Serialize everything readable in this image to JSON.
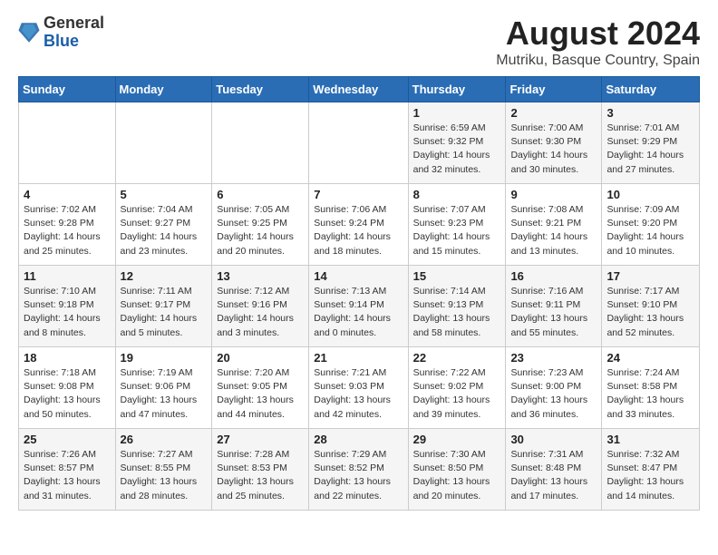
{
  "header": {
    "logo_general": "General",
    "logo_blue": "Blue",
    "month_title": "August 2024",
    "location": "Mutriku, Basque Country, Spain"
  },
  "weekdays": [
    "Sunday",
    "Monday",
    "Tuesday",
    "Wednesday",
    "Thursday",
    "Friday",
    "Saturday"
  ],
  "weeks": [
    [
      {
        "day": "",
        "detail": ""
      },
      {
        "day": "",
        "detail": ""
      },
      {
        "day": "",
        "detail": ""
      },
      {
        "day": "",
        "detail": ""
      },
      {
        "day": "1",
        "detail": "Sunrise: 6:59 AM\nSunset: 9:32 PM\nDaylight: 14 hours\nand 32 minutes."
      },
      {
        "day": "2",
        "detail": "Sunrise: 7:00 AM\nSunset: 9:30 PM\nDaylight: 14 hours\nand 30 minutes."
      },
      {
        "day": "3",
        "detail": "Sunrise: 7:01 AM\nSunset: 9:29 PM\nDaylight: 14 hours\nand 27 minutes."
      }
    ],
    [
      {
        "day": "4",
        "detail": "Sunrise: 7:02 AM\nSunset: 9:28 PM\nDaylight: 14 hours\nand 25 minutes."
      },
      {
        "day": "5",
        "detail": "Sunrise: 7:04 AM\nSunset: 9:27 PM\nDaylight: 14 hours\nand 23 minutes."
      },
      {
        "day": "6",
        "detail": "Sunrise: 7:05 AM\nSunset: 9:25 PM\nDaylight: 14 hours\nand 20 minutes."
      },
      {
        "day": "7",
        "detail": "Sunrise: 7:06 AM\nSunset: 9:24 PM\nDaylight: 14 hours\nand 18 minutes."
      },
      {
        "day": "8",
        "detail": "Sunrise: 7:07 AM\nSunset: 9:23 PM\nDaylight: 14 hours\nand 15 minutes."
      },
      {
        "day": "9",
        "detail": "Sunrise: 7:08 AM\nSunset: 9:21 PM\nDaylight: 14 hours\nand 13 minutes."
      },
      {
        "day": "10",
        "detail": "Sunrise: 7:09 AM\nSunset: 9:20 PM\nDaylight: 14 hours\nand 10 minutes."
      }
    ],
    [
      {
        "day": "11",
        "detail": "Sunrise: 7:10 AM\nSunset: 9:18 PM\nDaylight: 14 hours\nand 8 minutes."
      },
      {
        "day": "12",
        "detail": "Sunrise: 7:11 AM\nSunset: 9:17 PM\nDaylight: 14 hours\nand 5 minutes."
      },
      {
        "day": "13",
        "detail": "Sunrise: 7:12 AM\nSunset: 9:16 PM\nDaylight: 14 hours\nand 3 minutes."
      },
      {
        "day": "14",
        "detail": "Sunrise: 7:13 AM\nSunset: 9:14 PM\nDaylight: 14 hours\nand 0 minutes."
      },
      {
        "day": "15",
        "detail": "Sunrise: 7:14 AM\nSunset: 9:13 PM\nDaylight: 13 hours\nand 58 minutes."
      },
      {
        "day": "16",
        "detail": "Sunrise: 7:16 AM\nSunset: 9:11 PM\nDaylight: 13 hours\nand 55 minutes."
      },
      {
        "day": "17",
        "detail": "Sunrise: 7:17 AM\nSunset: 9:10 PM\nDaylight: 13 hours\nand 52 minutes."
      }
    ],
    [
      {
        "day": "18",
        "detail": "Sunrise: 7:18 AM\nSunset: 9:08 PM\nDaylight: 13 hours\nand 50 minutes."
      },
      {
        "day": "19",
        "detail": "Sunrise: 7:19 AM\nSunset: 9:06 PM\nDaylight: 13 hours\nand 47 minutes."
      },
      {
        "day": "20",
        "detail": "Sunrise: 7:20 AM\nSunset: 9:05 PM\nDaylight: 13 hours\nand 44 minutes."
      },
      {
        "day": "21",
        "detail": "Sunrise: 7:21 AM\nSunset: 9:03 PM\nDaylight: 13 hours\nand 42 minutes."
      },
      {
        "day": "22",
        "detail": "Sunrise: 7:22 AM\nSunset: 9:02 PM\nDaylight: 13 hours\nand 39 minutes."
      },
      {
        "day": "23",
        "detail": "Sunrise: 7:23 AM\nSunset: 9:00 PM\nDaylight: 13 hours\nand 36 minutes."
      },
      {
        "day": "24",
        "detail": "Sunrise: 7:24 AM\nSunset: 8:58 PM\nDaylight: 13 hours\nand 33 minutes."
      }
    ],
    [
      {
        "day": "25",
        "detail": "Sunrise: 7:26 AM\nSunset: 8:57 PM\nDaylight: 13 hours\nand 31 minutes."
      },
      {
        "day": "26",
        "detail": "Sunrise: 7:27 AM\nSunset: 8:55 PM\nDaylight: 13 hours\nand 28 minutes."
      },
      {
        "day": "27",
        "detail": "Sunrise: 7:28 AM\nSunset: 8:53 PM\nDaylight: 13 hours\nand 25 minutes."
      },
      {
        "day": "28",
        "detail": "Sunrise: 7:29 AM\nSunset: 8:52 PM\nDaylight: 13 hours\nand 22 minutes."
      },
      {
        "day": "29",
        "detail": "Sunrise: 7:30 AM\nSunset: 8:50 PM\nDaylight: 13 hours\nand 20 minutes."
      },
      {
        "day": "30",
        "detail": "Sunrise: 7:31 AM\nSunset: 8:48 PM\nDaylight: 13 hours\nand 17 minutes."
      },
      {
        "day": "31",
        "detail": "Sunrise: 7:32 AM\nSunset: 8:47 PM\nDaylight: 13 hours\nand 14 minutes."
      }
    ]
  ]
}
